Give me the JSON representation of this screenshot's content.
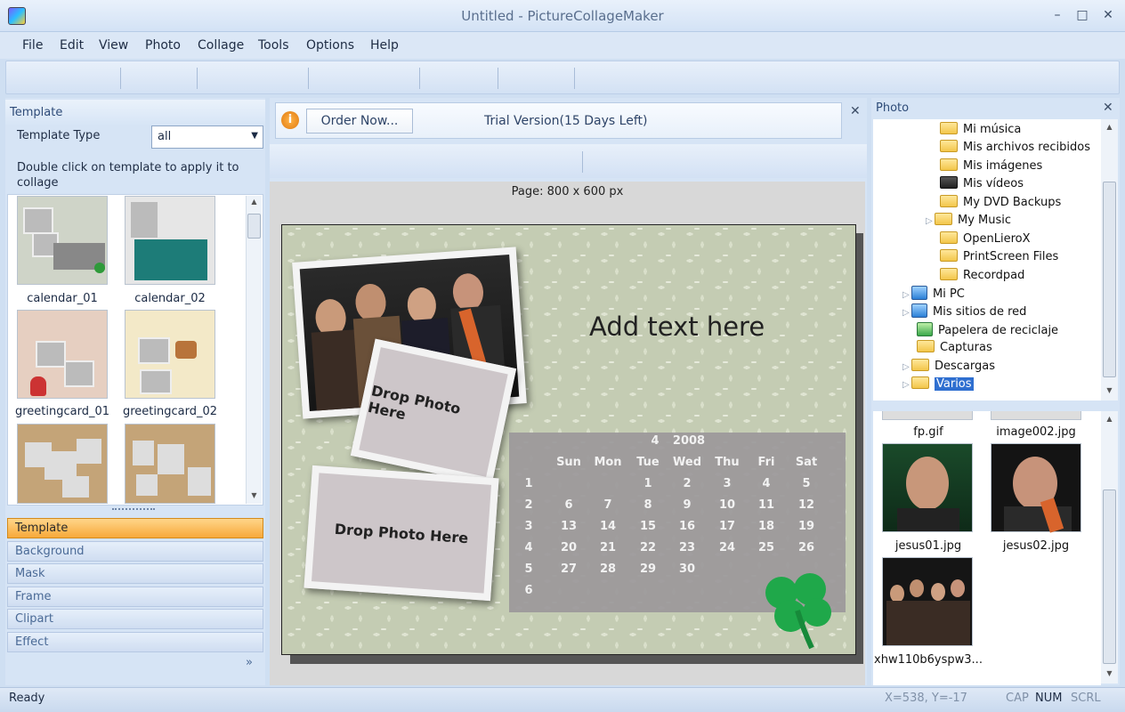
{
  "window": {
    "title": "Untitled - PictureCollageMaker"
  },
  "menu": [
    "File",
    "Edit",
    "View",
    "Photo",
    "Collage",
    "Tools",
    "Options",
    "Help"
  ],
  "left": {
    "header": "Template",
    "type_label": "Template Type",
    "type_value": "all",
    "hint": "Double click on template to apply it to collage",
    "templates": [
      "calendar_01",
      "calendar_02",
      "greetingcard_01",
      "greetingcard_02"
    ],
    "categories": [
      "Template",
      "Background",
      "Mask",
      "Frame",
      "Clipart",
      "Effect"
    ],
    "more": "»"
  },
  "center": {
    "order_label": "Order Now...",
    "trial_text": "Trial Version(15 Days Left)",
    "page_size": "Page: 800 x 600 px",
    "add_text": "Add text here",
    "drop1": "Drop Photo Here",
    "drop2": "Drop Photo Here",
    "calendar": {
      "month": "4",
      "year": "2008",
      "days": [
        "Sun",
        "Mon",
        "Tue",
        "Wed",
        "Thu",
        "Fri",
        "Sat"
      ],
      "weeks": [
        [
          "1",
          "",
          "",
          "1",
          "2",
          "3",
          "4",
          "5"
        ],
        [
          "2",
          "6",
          "7",
          "8",
          "9",
          "10",
          "11",
          "12"
        ],
        [
          "3",
          "13",
          "14",
          "15",
          "16",
          "17",
          "18",
          "19"
        ],
        [
          "4",
          "20",
          "21",
          "22",
          "23",
          "24",
          "25",
          "26"
        ],
        [
          "5",
          "27",
          "28",
          "29",
          "30",
          "",
          "",
          ""
        ],
        [
          "6",
          "",
          "",
          "",
          "",
          "",
          "",
          ""
        ]
      ]
    }
  },
  "right": {
    "header": "Photo",
    "tree": [
      "Mi música",
      "Mis archivos recibidos",
      "Mis imágenes",
      "Mis vídeos",
      "My DVD Backups",
      "My Music",
      "OpenLieroX",
      "PrintScreen Files",
      "Recordpad",
      "Mi PC",
      "Mis sitios de red",
      "Papelera de reciclaje",
      "Capturas",
      "Descargas",
      "Varios"
    ],
    "files": [
      "fp.gif",
      "image002.jpg",
      "jesus01.jpg",
      "jesus02.jpg",
      "xhw110b6yspw3..."
    ]
  },
  "status": {
    "ready": "Ready",
    "coords": "X=538, Y=-17",
    "cap": "CAP",
    "num": "NUM",
    "scrl": "SCRL"
  },
  "colors": {
    "accent": "#f7a93a",
    "panel": "#d6e4f5"
  }
}
